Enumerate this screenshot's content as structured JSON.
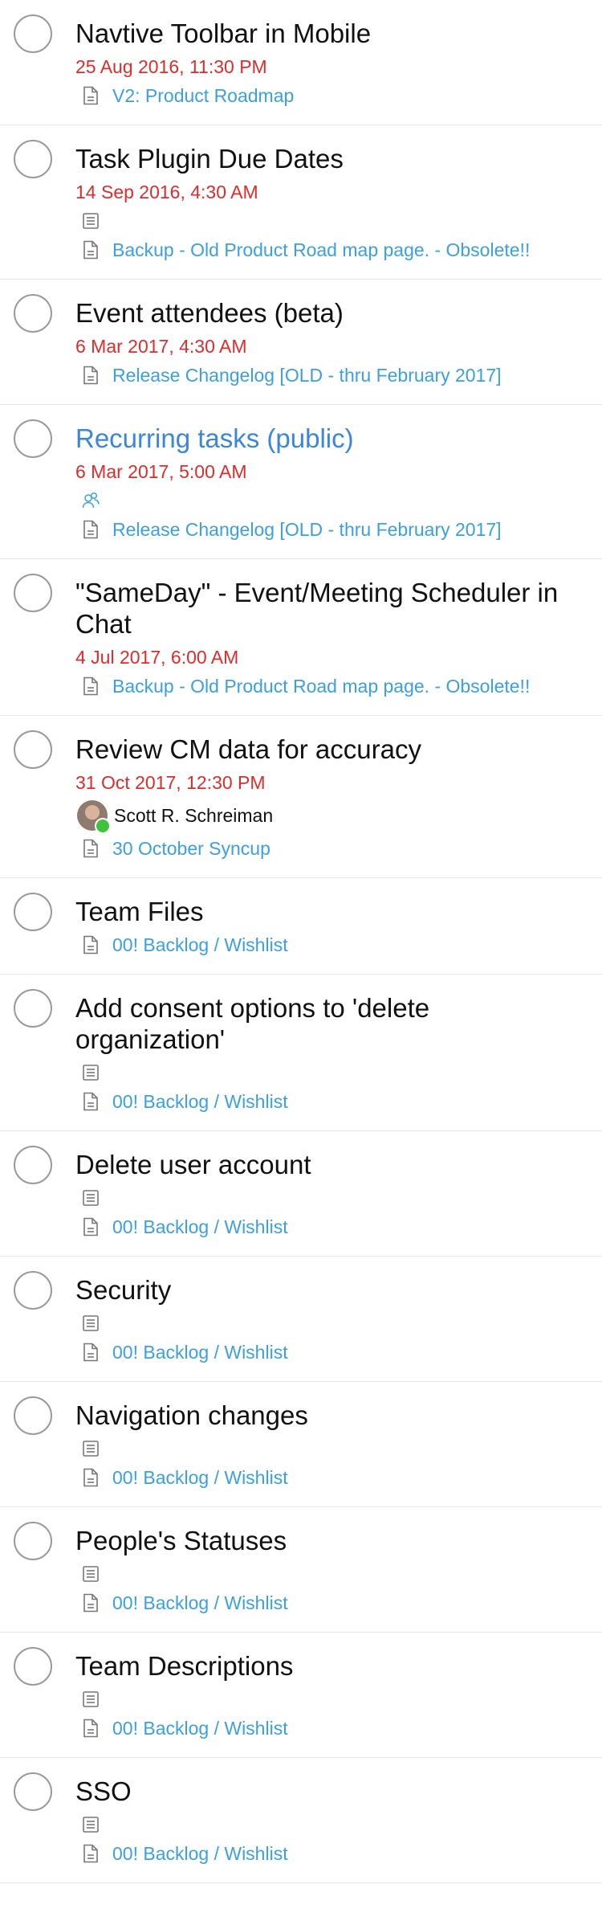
{
  "tasks": [
    {
      "title": "Navtive Toolbar in Mobile",
      "due": "25 Aug 2016, 11:30 PM",
      "parent": "V2: Product Roadmap"
    },
    {
      "title": "Task Plugin Due Dates",
      "due": "14 Sep 2016, 4:30 AM",
      "parent": "Backup - Old Product Road map page. - Obsolete!!"
    },
    {
      "title": "Event attendees (beta)",
      "due": "6 Mar 2017, 4:30 AM",
      "parent": "Release Changelog [OLD - thru February 2017]"
    },
    {
      "title": "Recurring tasks (public)",
      "due": "6 Mar 2017, 5:00 AM",
      "parent": "Release Changelog [OLD - thru February 2017]"
    },
    {
      "title": "\"SameDay\" - Event/Meeting Scheduler in Chat",
      "due": "4 Jul 2017, 6:00 AM",
      "parent": "Backup - Old Product Road map page. - Obsolete!!"
    },
    {
      "title": "Review CM data for accuracy",
      "due": "31 Oct 2017, 12:30 PM",
      "assignee": "Scott R. Schreiman",
      "parent": "30 October Syncup"
    },
    {
      "title": "Team Files",
      "parent": "00! Backlog / Wishlist"
    },
    {
      "title": "Add consent options to 'delete organization'",
      "parent": "00! Backlog / Wishlist"
    },
    {
      "title": "Delete user account",
      "parent": "00! Backlog / Wishlist"
    },
    {
      "title": "Security",
      "parent": "00! Backlog / Wishlist"
    },
    {
      "title": "Navigation changes",
      "parent": "00! Backlog / Wishlist"
    },
    {
      "title": "People's Statuses",
      "parent": "00! Backlog / Wishlist"
    },
    {
      "title": "Team Descriptions",
      "parent": "00! Backlog / Wishlist"
    },
    {
      "title": "SSO",
      "parent": "00! Backlog / Wishlist"
    }
  ],
  "icons": {
    "description": "description-icon",
    "page": "page-icon",
    "people": "people-icon"
  },
  "colors": {
    "due": "#e02b2b",
    "link": "#3aa0e0",
    "title_link": "#3b86dd",
    "online": "#3fc240"
  }
}
